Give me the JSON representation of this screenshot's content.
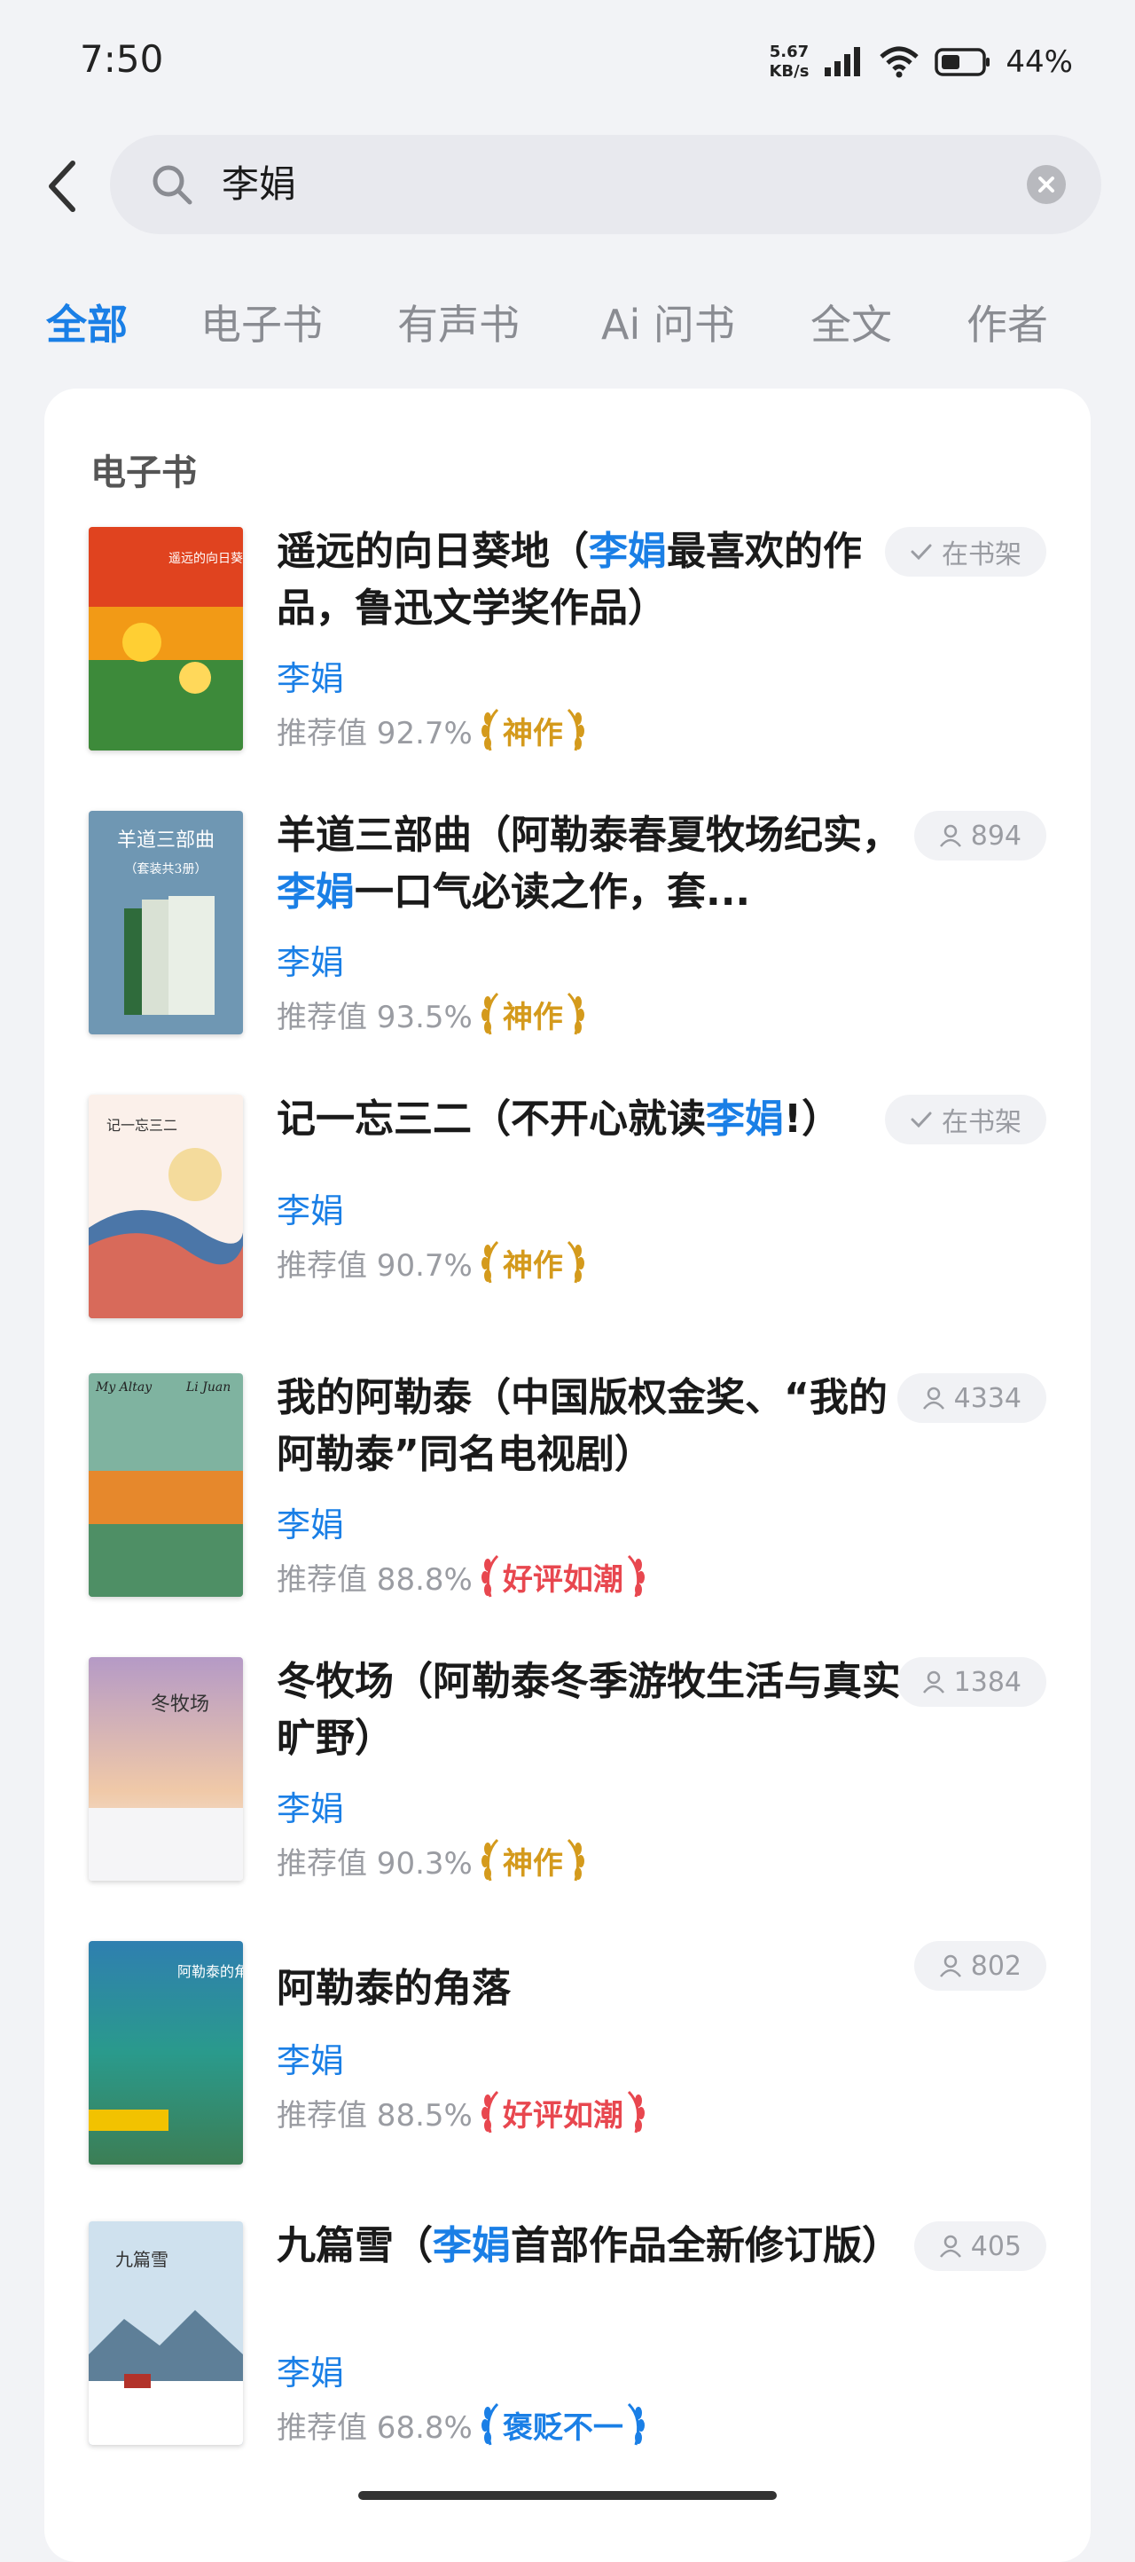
{
  "status_bar": {
    "time": "7:50",
    "net_speed_value": "5.67",
    "net_speed_unit": "KB/s",
    "battery_pct": "44%"
  },
  "search": {
    "query": "李娟"
  },
  "tabs": [
    {
      "label": "全部",
      "active": true
    },
    {
      "label": "电子书"
    },
    {
      "label": "有声书"
    },
    {
      "label": "Ai 问书"
    },
    {
      "label": "全文"
    },
    {
      "label": "作者"
    }
  ],
  "section": {
    "title": "电子书"
  },
  "books": [
    {
      "title_a": "遥远的向日葵地（",
      "title_hl": "李娟",
      "title_b": "最喜欢的作品，鲁迅文学奖作品）",
      "author": "李娟",
      "rating_label": "推荐值 92.7%",
      "badge": "神作",
      "badge_type": "gold",
      "pill": "在书架",
      "pill_type": "shelf"
    },
    {
      "title_a": "羊道三部曲（阿勒泰春夏牧场纪实，",
      "title_hl": "李娟",
      "title_b": "一口气必读之作，套...",
      "author": "李娟",
      "rating_label": "推荐值 93.5%",
      "badge": "神作",
      "badge_type": "gold",
      "pill": "894",
      "pill_type": "readers"
    },
    {
      "title_a": "记一忘三二（不开心就读",
      "title_hl": "李娟",
      "title_b": "!）",
      "author": "李娟",
      "rating_label": "推荐值 90.7%",
      "badge": "神作",
      "badge_type": "gold",
      "pill": "在书架",
      "pill_type": "shelf"
    },
    {
      "title_a": "我的阿勒泰（中国版权金奖、“我的阿勒泰”同名电视剧）",
      "title_hl": "",
      "title_b": "",
      "author": "李娟",
      "rating_label": "推荐值 88.8%",
      "badge": "好评如潮",
      "badge_type": "red",
      "pill": "4334",
      "pill_type": "readers"
    },
    {
      "title_a": "冬牧场（阿勒泰冬季游牧生活与真实旷野）",
      "title_hl": "",
      "title_b": "",
      "author": "李娟",
      "rating_label": "推荐值 90.3%",
      "badge": "神作",
      "badge_type": "gold",
      "pill": "1384",
      "pill_type": "readers"
    },
    {
      "title_a": "阿勒泰的角落",
      "title_hl": "",
      "title_b": "",
      "author": "李娟",
      "rating_label": "推荐值 88.5%",
      "badge": "好评如潮",
      "badge_type": "red",
      "pill": "802",
      "pill_type": "readers"
    },
    {
      "title_a": "九篇雪（",
      "title_hl": "李娟",
      "title_b": "首部作品全新修订版）",
      "author": "李娟",
      "rating_label": "推荐值 68.8%",
      "badge": "褒贬不一",
      "badge_type": "blue",
      "pill": "405",
      "pill_type": "readers"
    }
  ],
  "covers": [
    {
      "text": "遥远的向日葵地 · 李娟",
      "colors": [
        "#e0431f",
        "#f29a16",
        "#3d8a3a"
      ]
    },
    {
      "text": "羊道三部曲",
      "subtext": "（套装共3册）",
      "colors": [
        "#6f97b3",
        "#5e86a4",
        "#d9e1d4"
      ]
    },
    {
      "text": "记一忘三二",
      "colors": [
        "#fbf0ea",
        "#f3dcd4",
        "#4b76a8"
      ]
    },
    {
      "text": "My Altay",
      "subtext": "Li Juan",
      "colors": [
        "#7fb3a0",
        "#e6882c",
        "#4e8f65"
      ]
    },
    {
      "text": "冬牧场",
      "colors": [
        "#b59ac6",
        "#f0c9a8",
        "#f5f5f7"
      ]
    },
    {
      "text": "阿勒泰的角落",
      "colors": [
        "#2f7fb0",
        "#2a9a8c",
        "#3c7e55"
      ]
    },
    {
      "text": "九篇雪",
      "colors": [
        "#cfe1ee",
        "#5e7f98",
        "#ffffff"
      ]
    }
  ],
  "colors": {
    "accent": "#1a7fe6",
    "gold": "#d49a1c",
    "red": "#e8474f",
    "muted": "#9a9ca2"
  }
}
